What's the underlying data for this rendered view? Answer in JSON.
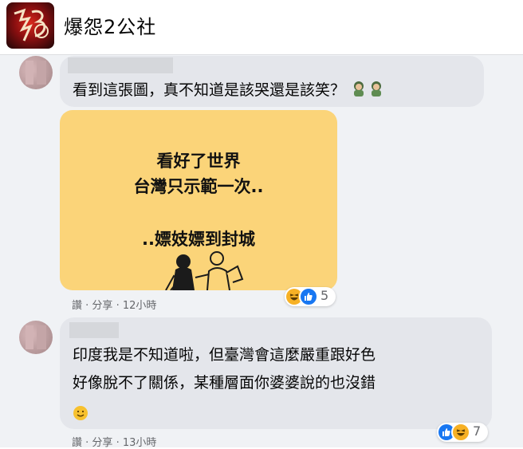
{
  "group": {
    "name": "爆怨2公社"
  },
  "comments": [
    {
      "text": "看到這張圖，真不知道是該哭還是該笑？",
      "image_lines": [
        "看好了世界",
        "台灣只示範一次..",
        "..嫖妓嫖到封城"
      ],
      "actions": {
        "like": "讚",
        "sep": " · ",
        "reply": "分享",
        "time": "12小時"
      },
      "reactions": {
        "types": [
          "haha",
          "like"
        ],
        "count": "5"
      }
    },
    {
      "lines": [
        "印度我是不知道啦，但臺灣會這麼嚴重跟好色",
        "好像脫不了關係，某種層面你婆婆說的也沒錯"
      ],
      "actions": {
        "like": "讚",
        "sep": " · ",
        "reply": "分享",
        "time": "13小時"
      },
      "reactions": {
        "types": [
          "like",
          "haha"
        ],
        "count": "7"
      }
    }
  ]
}
